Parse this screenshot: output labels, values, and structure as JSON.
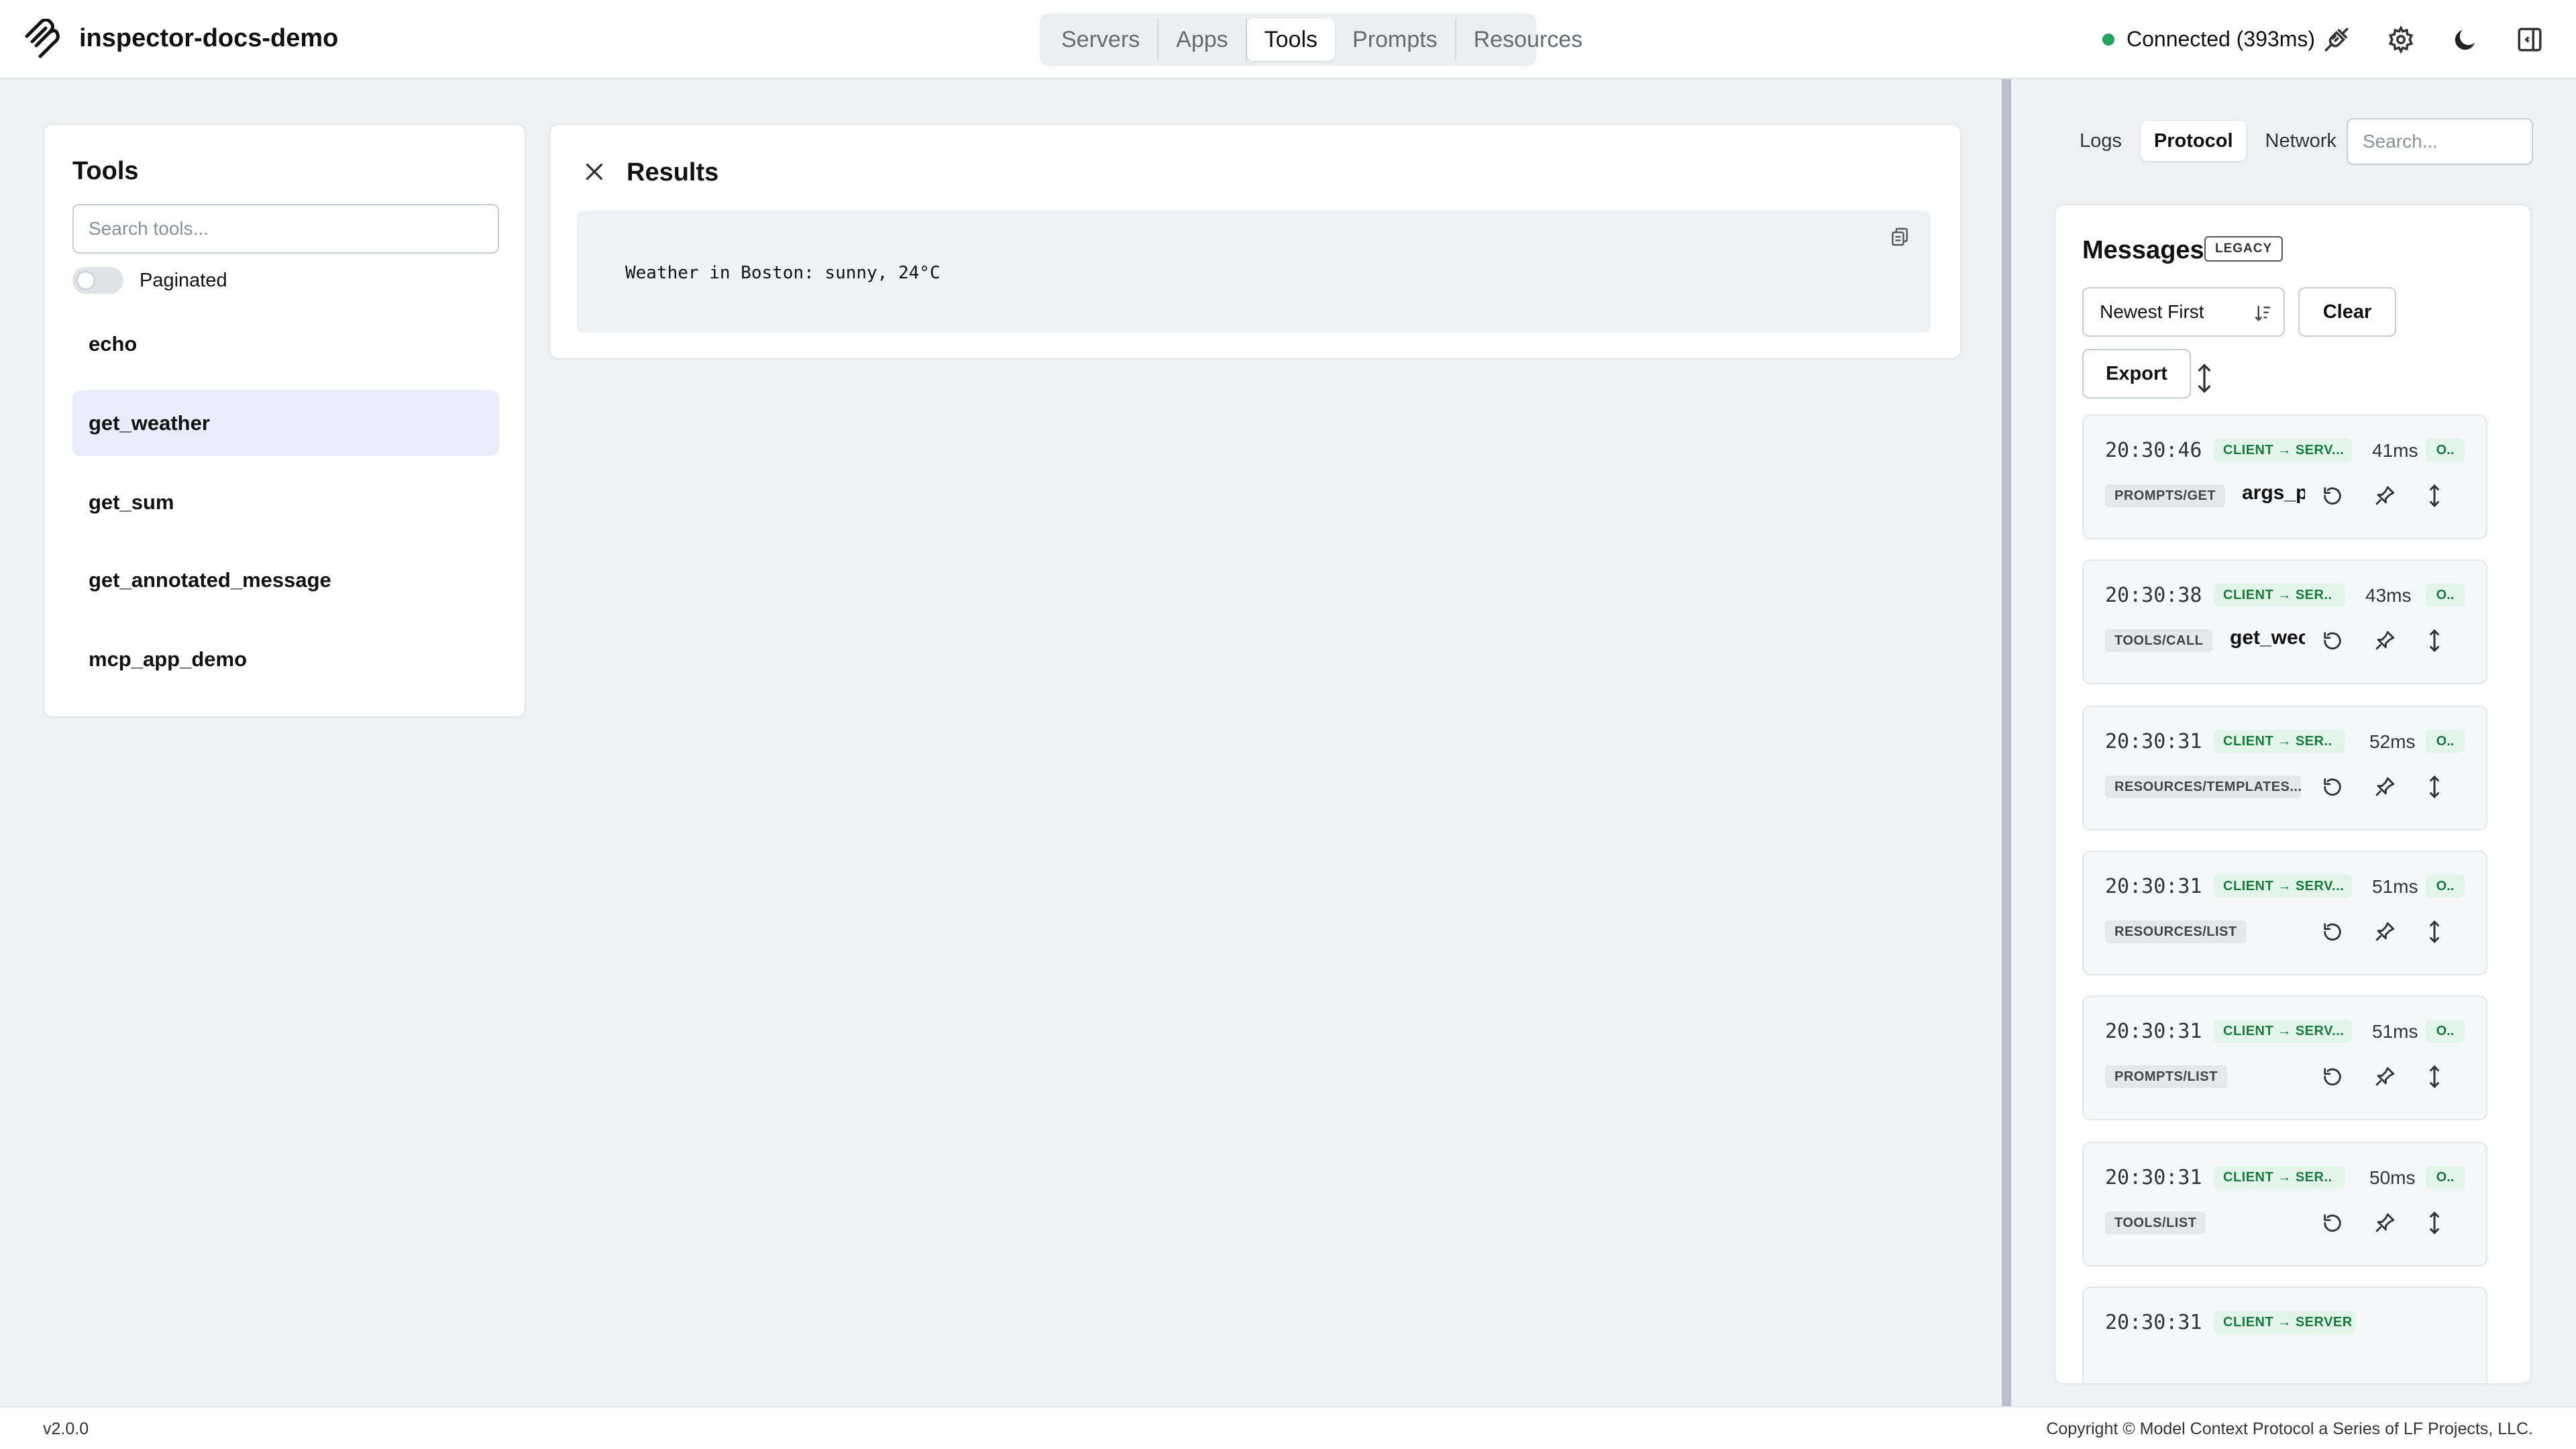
{
  "header": {
    "app_title": "inspector-docs-demo",
    "nav": [
      "Servers",
      "Apps",
      "Tools",
      "Prompts",
      "Resources"
    ],
    "active_nav": "Tools",
    "status_text": "Connected (393ms)",
    "status_color": "#22a55a",
    "icons": [
      "plug-icon",
      "gear-icon",
      "moon-icon",
      "panel-toggle-icon"
    ]
  },
  "tools_panel": {
    "title": "Tools",
    "search_placeholder": "Search tools...",
    "paginated_label": "Paginated",
    "paginated_on": false,
    "items": [
      "echo",
      "get_weather",
      "get_sum",
      "get_annotated_message",
      "mcp_app_demo"
    ],
    "selected": "get_weather"
  },
  "results": {
    "title": "Results",
    "text": "Weather in Boston: sunny, 24°C"
  },
  "right_panel": {
    "tabs": [
      "Logs",
      "Protocol",
      "Network"
    ],
    "active_tab": "Protocol",
    "search_placeholder": "Search...",
    "messages_title": "Messages",
    "legacy_badge": "LEGACY",
    "sort_label": "Newest First",
    "clear_label": "Clear",
    "export_label": "Export",
    "messages": [
      {
        "time": "20:30:46",
        "direction": "CLIENT → SERV...",
        "duration": "41ms",
        "status": "O..",
        "method": "PROMPTS/GET",
        "name": "args_p"
      },
      {
        "time": "20:30:38",
        "direction": "CLIENT → SER..",
        "duration": "43ms",
        "status": "O..",
        "method": "TOOLS/CALL",
        "name": "get_wec"
      },
      {
        "time": "20:30:31",
        "direction": "CLIENT → SER..",
        "duration": "52ms",
        "status": "O..",
        "method": "RESOURCES/TEMPLATES...",
        "name": ""
      },
      {
        "time": "20:30:31",
        "direction": "CLIENT → SERV...",
        "duration": "51ms",
        "status": "O..",
        "method": "RESOURCES/LIST",
        "name": ""
      },
      {
        "time": "20:30:31",
        "direction": "CLIENT → SERV...",
        "duration": "51ms",
        "status": "O..",
        "method": "PROMPTS/LIST",
        "name": ""
      },
      {
        "time": "20:30:31",
        "direction": "CLIENT → SER..",
        "duration": "50ms",
        "status": "O..",
        "method": "TOOLS/LIST",
        "name": ""
      },
      {
        "time": "20:30:31",
        "direction": "CLIENT → SERVER",
        "duration": "",
        "status": "",
        "method": "",
        "name": ""
      }
    ]
  },
  "footer": {
    "version": "v2.0.0",
    "copyright": "Copyright © Model Context Protocol a Series of LF Projects, LLC."
  }
}
